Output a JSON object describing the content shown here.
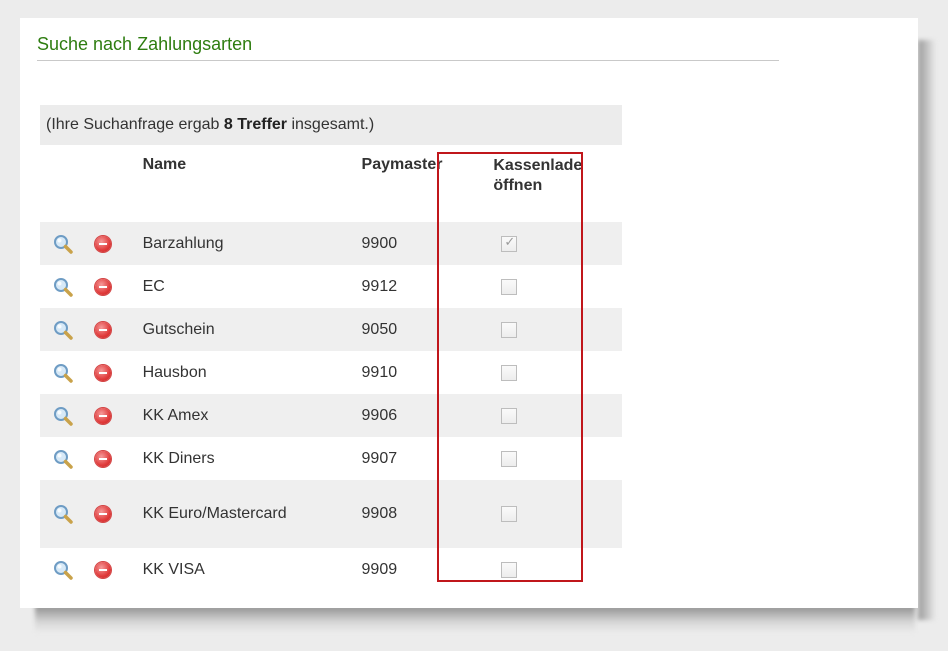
{
  "page": {
    "title": "Suche nach Zahlungsarten"
  },
  "results_info": {
    "prefix": "(Ihre Suchanfrage ergab ",
    "count": "8 Treffer",
    "suffix": " insgesamt.)"
  },
  "columns": {
    "name": "Name",
    "paymaster": "Paymaster",
    "kassenlade": "Kassenlade öffnen"
  },
  "rows": [
    {
      "name": "Barzahlung",
      "paymaster": "9900",
      "kassenlade_checked": true
    },
    {
      "name": "EC",
      "paymaster": "9912",
      "kassenlade_checked": false
    },
    {
      "name": "Gutschein",
      "paymaster": "9050",
      "kassenlade_checked": false
    },
    {
      "name": "Hausbon",
      "paymaster": "9910",
      "kassenlade_checked": false
    },
    {
      "name": "KK Amex",
      "paymaster": "9906",
      "kassenlade_checked": false
    },
    {
      "name": "KK Diners",
      "paymaster": "9907",
      "kassenlade_checked": false
    },
    {
      "name": "KK Euro/Mastercard",
      "paymaster": "9908",
      "kassenlade_checked": false
    },
    {
      "name": "KK VISA",
      "paymaster": "9909",
      "kassenlade_checked": false
    }
  ],
  "icons": {
    "view": "magnifier-icon",
    "delete": "delete-icon"
  },
  "colors": {
    "title": "#2e7d10",
    "highlight": "#c0161b",
    "delete": "#e03b3b"
  }
}
